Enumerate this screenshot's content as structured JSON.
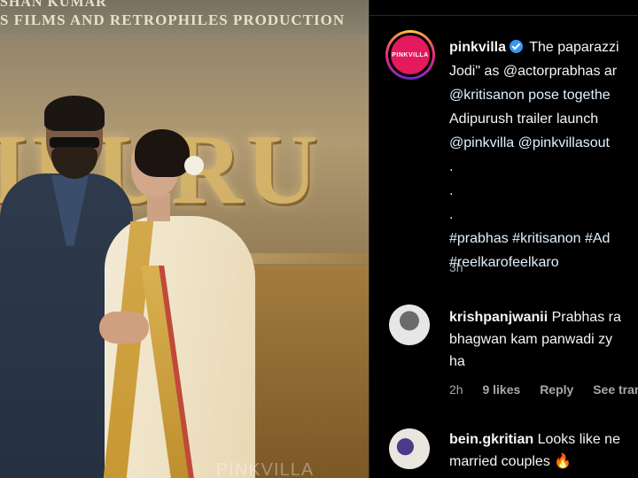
{
  "media": {
    "credit_line1": "SHAN KUMAR",
    "credit_line2": "S FILMS AND RETROPHILES PRODUCTION",
    "poster_title": "IPURU",
    "watermark": "PINKVILLA"
  },
  "post": {
    "avatar_logo": "PINKVILLA",
    "username": "pinkvilla",
    "caption_lines": [
      "The paparazzi",
      "Jodi\" as @actorprabhas ar",
      "@kritisanon pose togethe",
      "Adipurush trailer launch",
      "@pinkvilla @pinkvillasout",
      ".",
      ".",
      ".",
      "#prabhas #kritisanon #Ad",
      "#reelkarofeelkaro"
    ],
    "time": "3h"
  },
  "comments": [
    {
      "username": "krishpanjwanii",
      "text_lines": [
        "Prabhas ra",
        "bhagwan kam panwadi zy",
        "ha"
      ],
      "time": "2h",
      "likes": "9 likes",
      "reply": "Reply",
      "translate": "See tran"
    },
    {
      "username": "bein.gkritian",
      "text_lines": [
        "Looks like ne",
        "married couples"
      ],
      "emoji": "🔥"
    }
  ],
  "colors": {
    "background": "#000000",
    "verified": "#3897f0",
    "muted_text": "#a8a8a8",
    "brand": "#e5195d"
  }
}
